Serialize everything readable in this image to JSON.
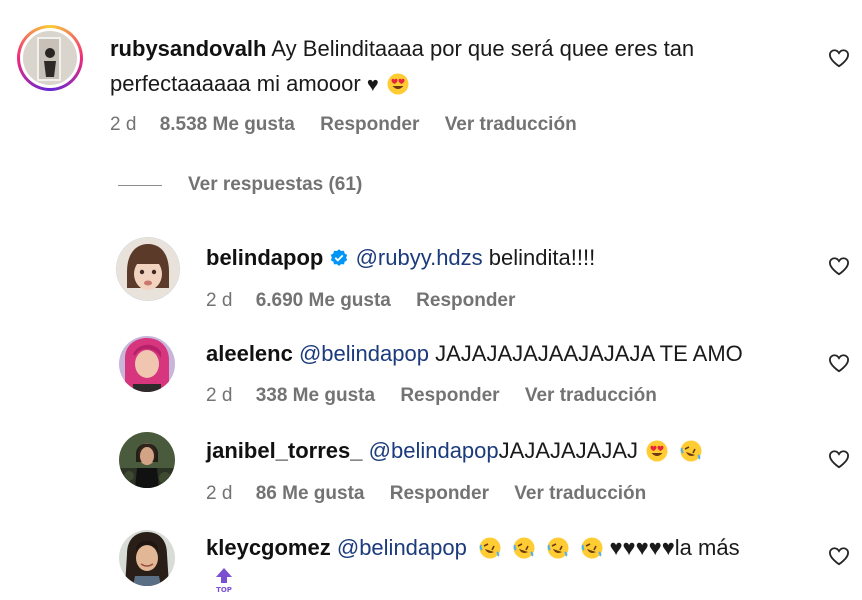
{
  "main_comment": {
    "username": "rubysandovalh",
    "text_line1": "Ay Belinditaaaa por que será quee eres tan",
    "text_line2": "perfectaaaaaa mi amooor",
    "time": "2 d",
    "likes": "8.538 Me gusta",
    "reply": "Responder",
    "translate": "Ver traducción"
  },
  "view_replies": "Ver respuestas (61)",
  "replies": [
    {
      "username": "belindapop",
      "verified": true,
      "mention": "@rubyy.hdzs",
      "text": "belindita!!!!",
      "time": "2 d",
      "likes": "6.690 Me gusta",
      "reply": "Responder"
    },
    {
      "username": "aleelenc",
      "mention": "@belindapop",
      "text": "JAJAJAJAJAAJAJAJA TE AMO",
      "time": "2 d",
      "likes": "338 Me gusta",
      "reply": "Responder",
      "translate": "Ver traducción"
    },
    {
      "username": "janibel_torres_",
      "mention": "@belindapop",
      "text": "JAJAJAJAJAJ",
      "time": "2 d",
      "likes": "86 Me gusta",
      "reply": "Responder",
      "translate": "Ver traducción"
    },
    {
      "username": "kleycgomez",
      "mention": "@belindapop",
      "text_tail": "♥♥♥♥♥la más"
    }
  ],
  "top_badge": "TOP",
  "icons": {
    "heart": "heart-outline-icon",
    "verified": "verified-badge-icon",
    "emoji_heart_eyes": "heart-eyes-emoji",
    "emoji_rofl": "rolling-laughing-emoji"
  },
  "colors": {
    "mention": "#1c3b7c",
    "meta": "#737373",
    "verified": "#0095f6"
  }
}
